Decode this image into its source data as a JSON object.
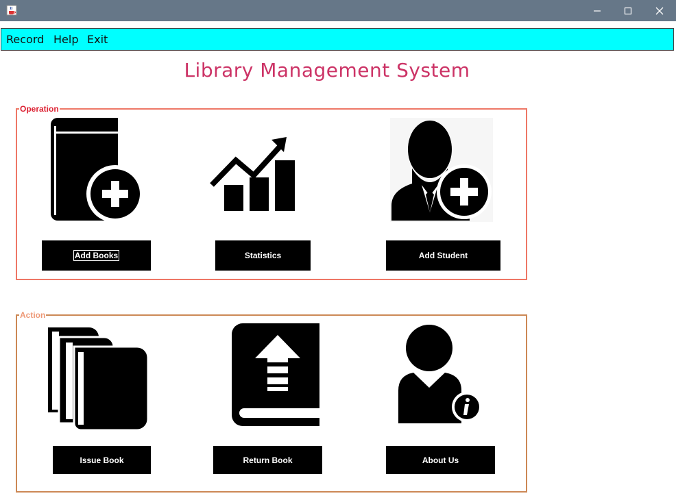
{
  "window": {
    "app_icon": "java-cup-icon",
    "controls": [
      "minimize-icon",
      "maximize-icon",
      "close-icon"
    ]
  },
  "menu": {
    "items": [
      {
        "label": "Record"
      },
      {
        "label": "Help"
      },
      {
        "label": "Exit"
      }
    ]
  },
  "title": "Library Management System",
  "colors": {
    "title": "#cc3366",
    "menubar": "#00ffff",
    "operation_border": "#ee7766",
    "operation_legend": "#dd2233",
    "action_border": "#cc8855",
    "action_legend": "#ee9977",
    "button_bg": "#000000",
    "button_text": "#ffffff"
  },
  "operation": {
    "legend": "Operation",
    "buttons": [
      {
        "label": "Add Books",
        "icon": "add-book-icon",
        "focused": true
      },
      {
        "label": "Statistics",
        "icon": "statistics-icon"
      },
      {
        "label": "Add Student",
        "icon": "add-student-icon"
      }
    ]
  },
  "action": {
    "legend": "Action",
    "buttons": [
      {
        "label": "Issue Book",
        "icon": "issue-book-icon"
      },
      {
        "label": "Return Book",
        "icon": "return-book-icon"
      },
      {
        "label": "About Us",
        "icon": "about-us-icon"
      }
    ]
  }
}
